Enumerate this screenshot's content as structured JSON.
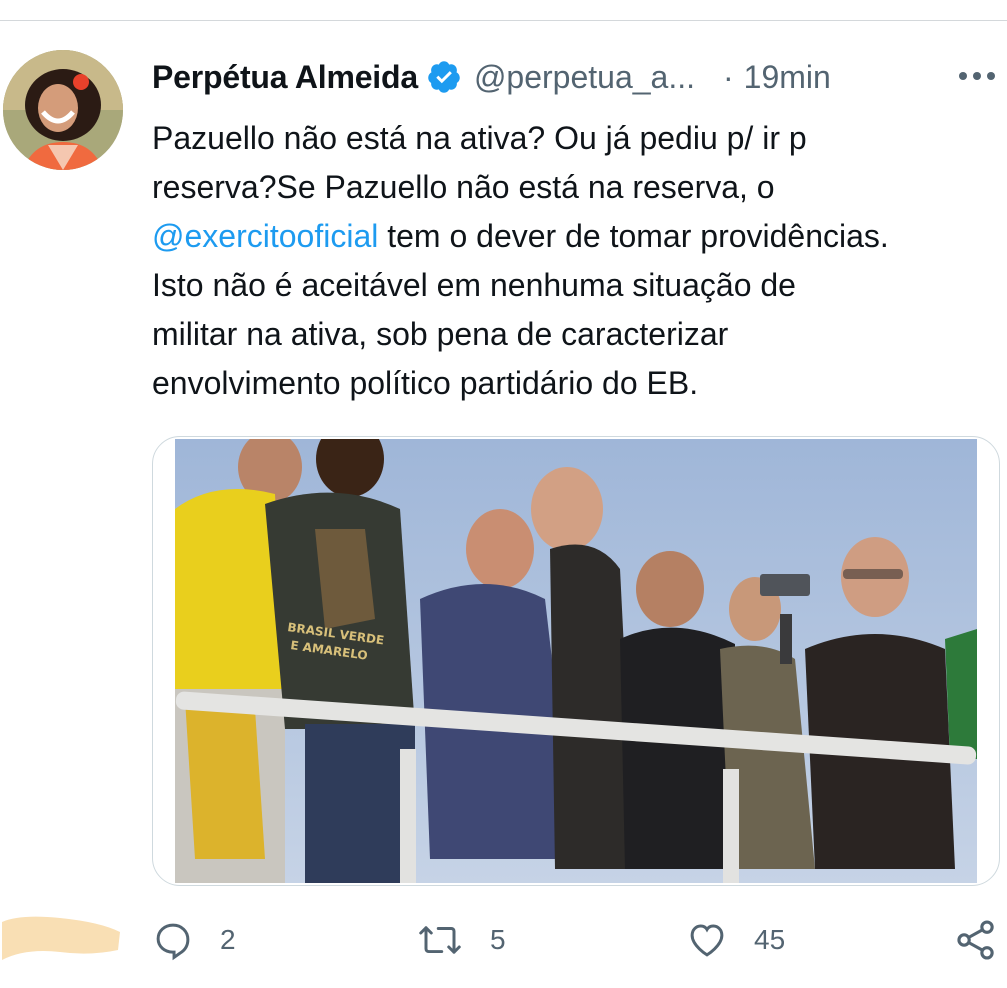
{
  "tweet": {
    "author_name": "Perpétua Almeida",
    "handle": "@perpetua_a...",
    "separator": "·",
    "time": "19min",
    "text_lines": [
      {
        "before": "Pazuello não está na ativa? Ou já pediu p/ ir p"
      },
      {
        "before": "reserva?Se Pazuello não está na reserva, o"
      },
      {
        "mention": "@exercitooficial",
        "after": " tem o dever de tomar providências."
      },
      {
        "before": "Isto não é aceitável em nenhuma situação de"
      },
      {
        "before": "militar na ativa, sob pena de caracterizar"
      },
      {
        "before": "envolvimento político partidário do EB."
      }
    ]
  },
  "media": {
    "shirt_text_1": "BRASIL VERDE",
    "shirt_text_2": "E AMARELO"
  },
  "actions": {
    "reply_count": "2",
    "retweet_count": "5",
    "like_count": "45"
  },
  "icons": {
    "verified": "verified-badge-icon",
    "more": "more-icon",
    "reply": "reply-icon",
    "retweet": "retweet-icon",
    "like": "heart-icon",
    "share": "share-icon"
  },
  "colors": {
    "accent": "#1d9bf0",
    "text": "#0f1419",
    "secondary": "#536471",
    "sticky_note": "#f9dfb4"
  }
}
